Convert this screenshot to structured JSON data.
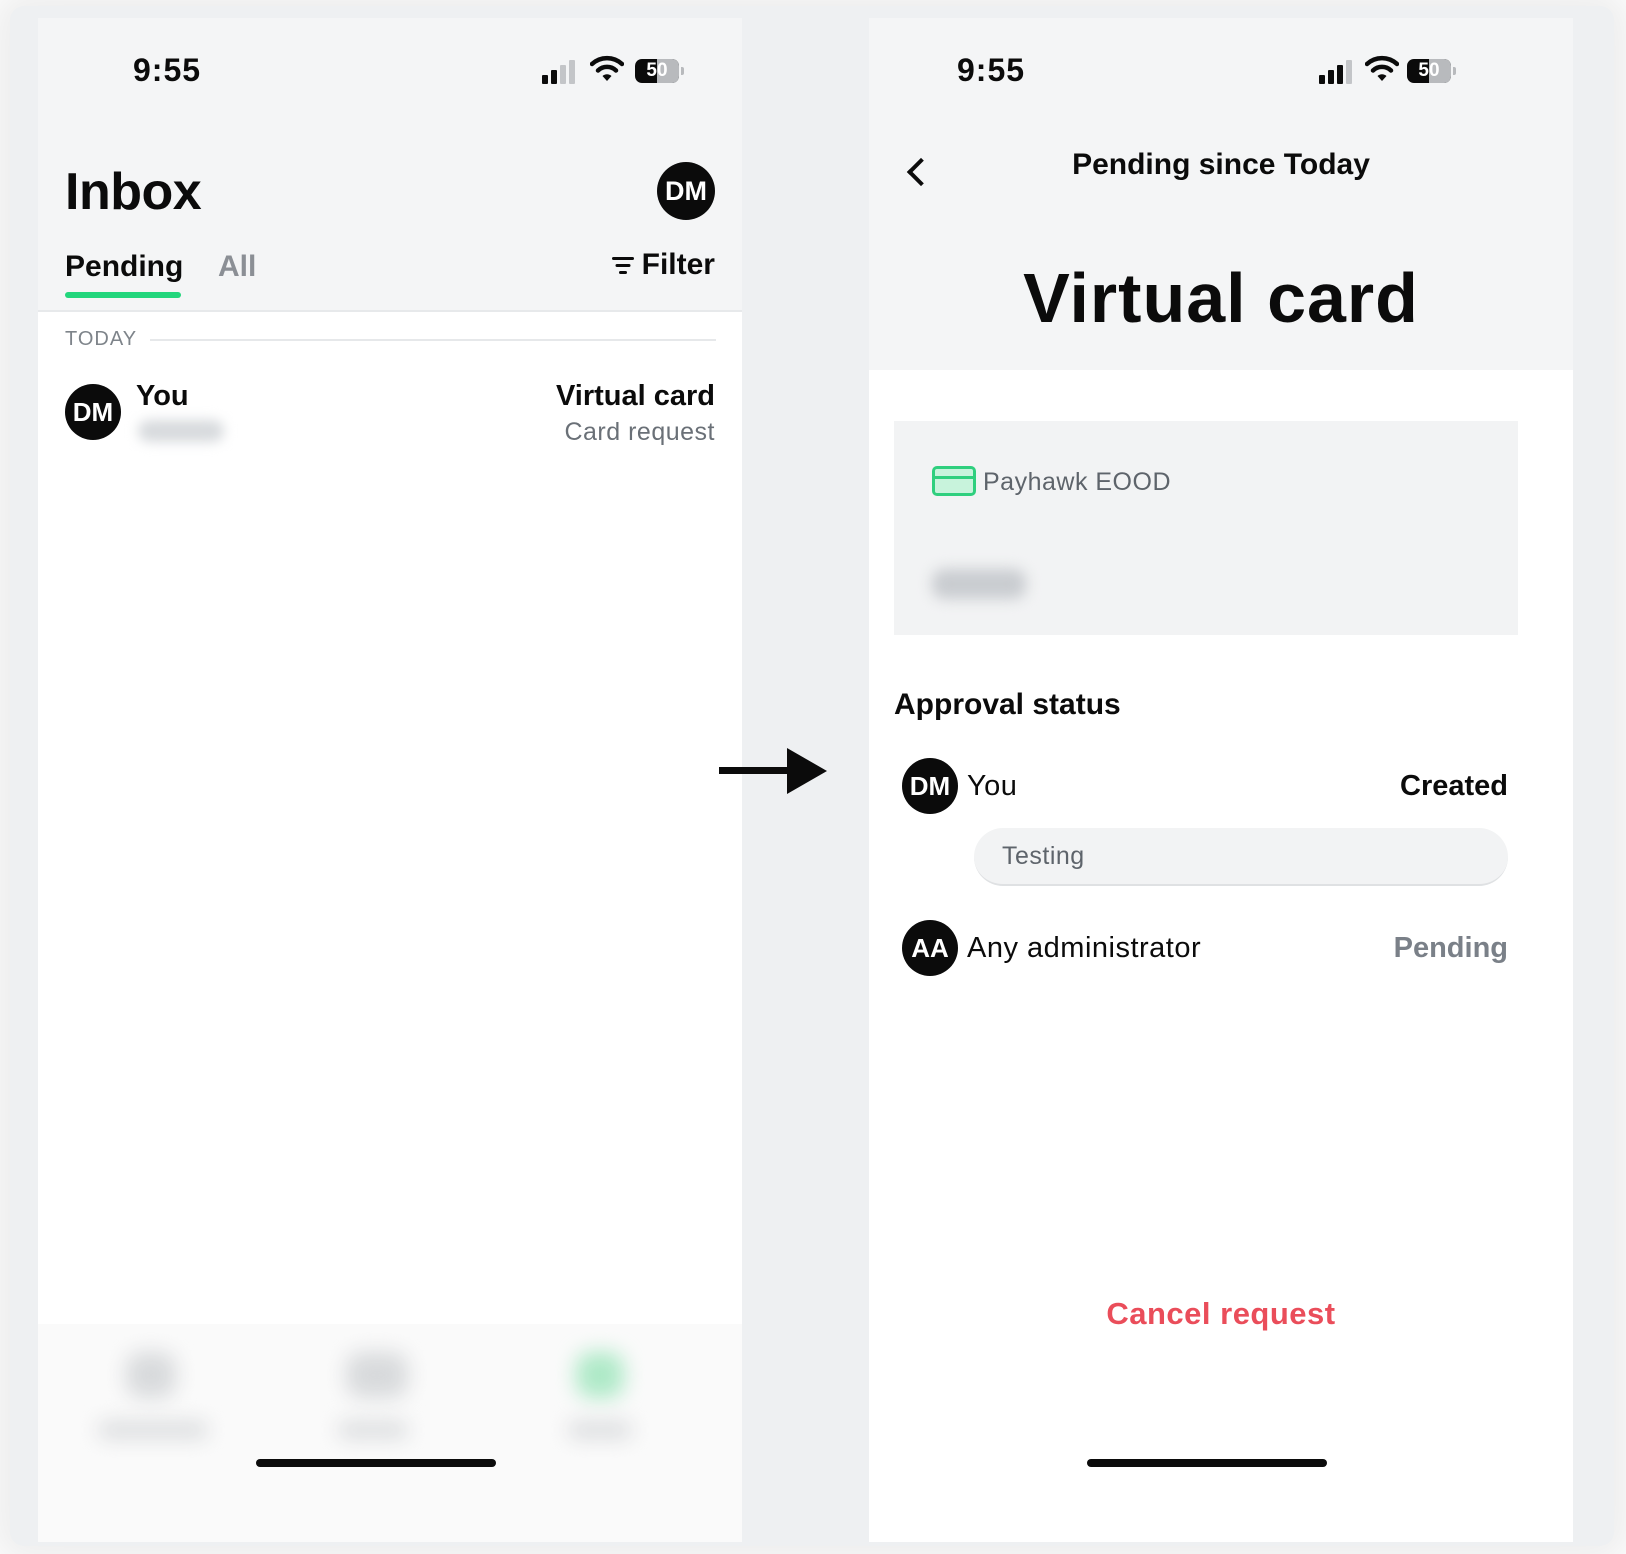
{
  "left_screen": {
    "status_bar": {
      "time": "9:55",
      "battery": "50",
      "battery_level": 0.5
    },
    "title": "Inbox",
    "profile_initials": "DM",
    "tabs": [
      {
        "label": "Pending",
        "active": true
      },
      {
        "label": "All",
        "active": false
      }
    ],
    "filter_label": "Filter",
    "section_label": "TODAY",
    "items": [
      {
        "initials": "DM",
        "name": "You",
        "type": "Virtual card",
        "subtitle": "Card request"
      }
    ]
  },
  "right_screen": {
    "status_bar": {
      "time": "9:55",
      "battery": "50",
      "battery_level": 0.5
    },
    "subtitle": "Pending since Today",
    "title": "Virtual card",
    "card": {
      "company": "Payhawk EOOD"
    },
    "approval_title": "Approval status",
    "approvers": [
      {
        "initials": "DM",
        "name": "You",
        "status": "Created",
        "comment": "Testing"
      },
      {
        "initials": "AA",
        "name": "Any administrator",
        "status": "Pending"
      }
    ],
    "cancel_label": "Cancel request"
  },
  "colors": {
    "accent_green": "#22d67c",
    "danger_red": "#ea4d5a",
    "header_bg": "#f4f5f6"
  }
}
